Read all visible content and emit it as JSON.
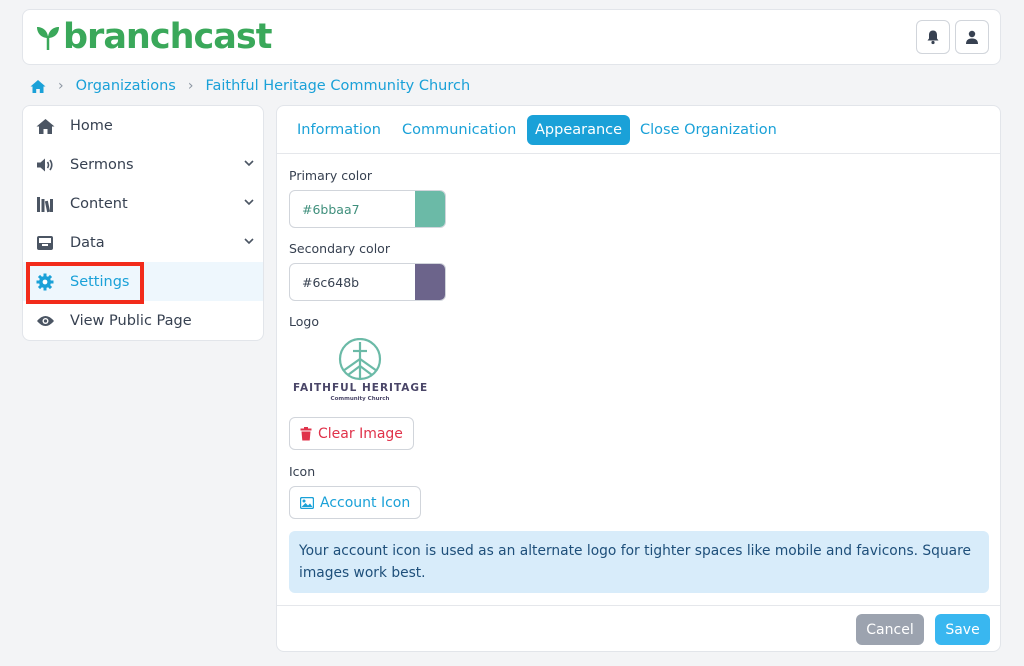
{
  "app": {
    "brand": "branchcast",
    "brand_color": "#3aa85a",
    "accent": "#1aa1d8"
  },
  "header": {
    "icons": [
      "bell-icon",
      "user-icon"
    ]
  },
  "breadcrumb": {
    "home_icon": "home-icon",
    "items": [
      "Organizations",
      "Faithful Heritage Community Church"
    ]
  },
  "sidebar": {
    "items": [
      {
        "label": "Home",
        "icon": "home-icon"
      },
      {
        "label": "Sermons",
        "icon": "volume-icon"
      },
      {
        "label": "Content",
        "icon": "library-icon"
      },
      {
        "label": "Data",
        "icon": "inbox-icon"
      },
      {
        "label": "Settings",
        "icon": "gear-icon"
      },
      {
        "label": "View Public Page",
        "icon": "eye-icon"
      }
    ],
    "active": "Settings"
  },
  "tabs": [
    "Information",
    "Communication",
    "Appearance",
    "Close Organization"
  ],
  "active_tab": "Appearance",
  "appearance": {
    "primary_label": "Primary color",
    "primary_value": "#6bbaa7",
    "primary_swatch": "#6bbaa7",
    "secondary_label": "Secondary color",
    "secondary_value": "#6c648b",
    "secondary_swatch": "#6c648b",
    "logo_label": "Logo",
    "logo_text_main": "FAITHFUL HERITAGE",
    "logo_text_sub": "Community Church",
    "clear_image": "Clear Image",
    "icon_label": "Icon",
    "account_icon": "Account Icon",
    "info": "Your account icon is used as an alternate logo for tighter spaces like mobile and favicons. Square images work best."
  },
  "footer": {
    "cancel": "Cancel",
    "save": "Save"
  }
}
